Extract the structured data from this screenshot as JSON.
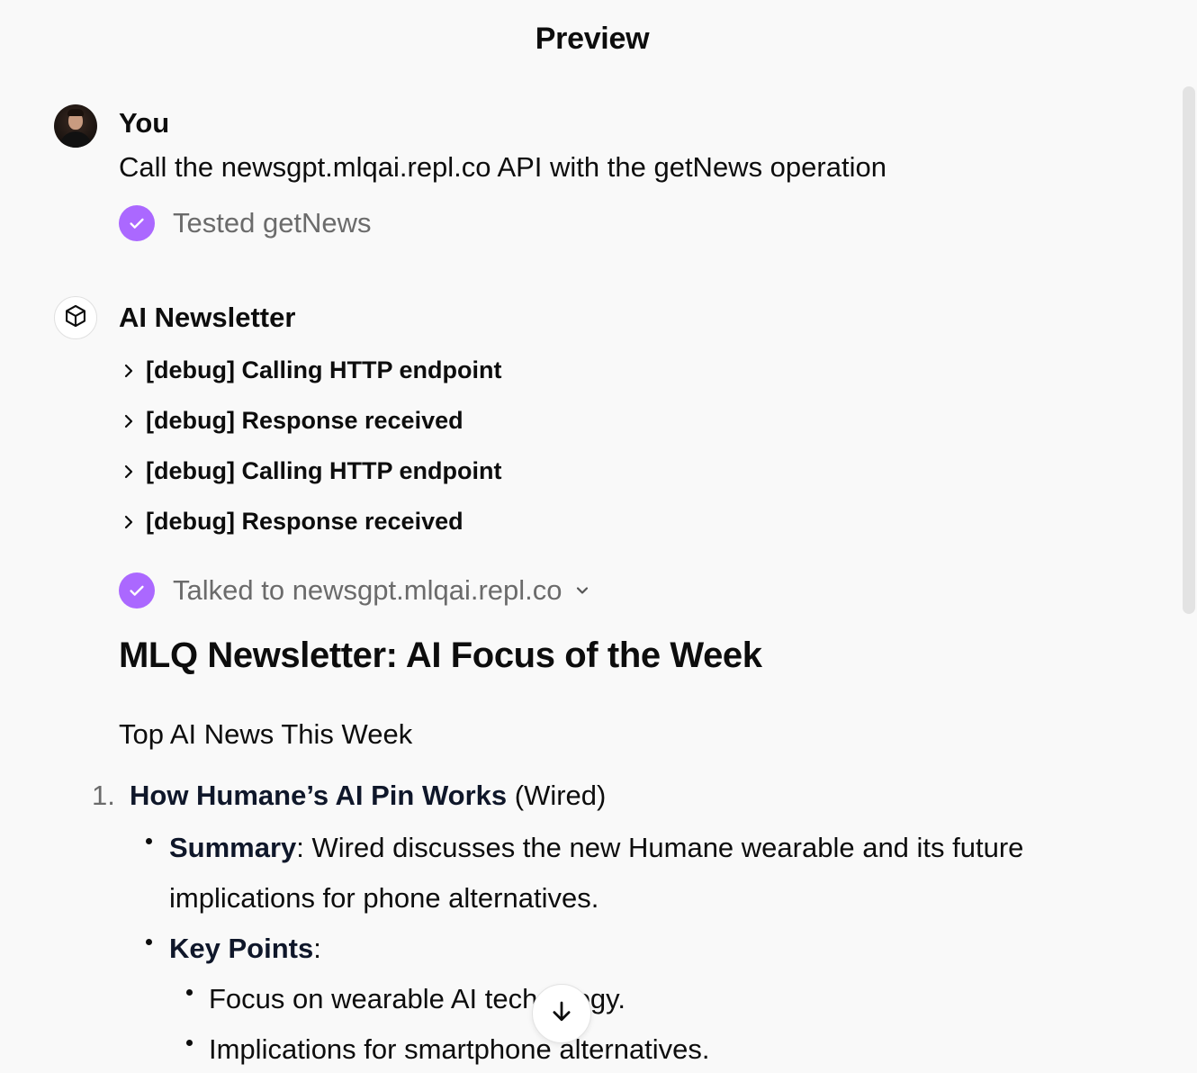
{
  "header": {
    "title": "Preview"
  },
  "user_message": {
    "author": "You",
    "text": "Call the newsgpt.mlqai.repl.co API with the getNews operation",
    "tool_status": "Tested getNews"
  },
  "bot_message": {
    "author": "AI Newsletter",
    "debug_items": [
      "[debug] Calling HTTP endpoint",
      "[debug] Response received",
      "[debug] Calling HTTP endpoint",
      "[debug] Response received"
    ],
    "tool_status": "Talked to newsgpt.mlqai.repl.co",
    "newsletter_title": "MLQ Newsletter: AI Focus of the Week",
    "section_heading": "Top AI News This Week",
    "item": {
      "number": "1.",
      "title": "How Humane’s AI Pin Works",
      "source": " (Wired)",
      "summary_label": "Summary",
      "summary_text": ": Wired discusses the new Humane wearable and its future",
      "summary_text_cont": "implications for phone alternatives.",
      "key_points_label": "Key Points",
      "key_points_colon": ":",
      "key_points": [
        "Focus on wearable AI technology.",
        "Implications for smartphone alternatives."
      ]
    }
  },
  "colors": {
    "accent": "#ab68ff",
    "background": "#f9f9f9",
    "muted_text": "#6b6b6b"
  },
  "icons": {
    "check": "check-icon",
    "bot": "cube-icon",
    "expand": "chevron-right-icon",
    "collapse": "chevron-down-icon",
    "scroll": "arrow-down-icon"
  }
}
